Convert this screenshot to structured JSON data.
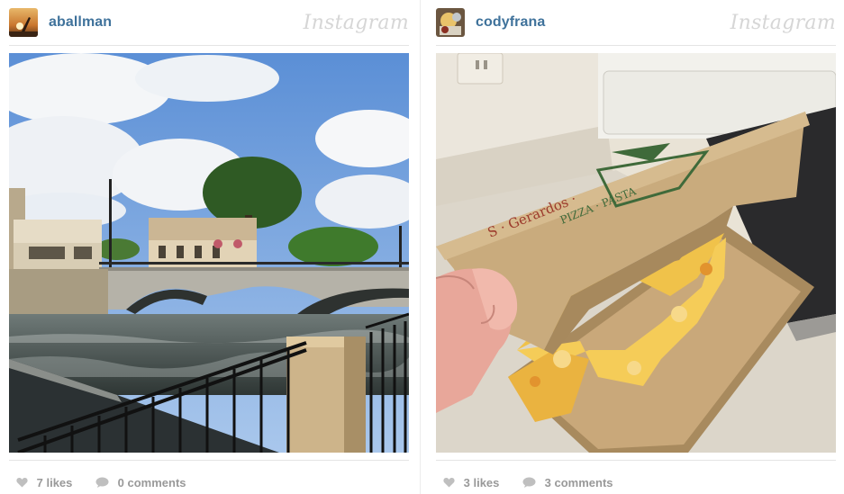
{
  "brand": "Instagram",
  "posts": [
    {
      "username": "aballman",
      "likes": "7 likes",
      "comments": "0 comments"
    },
    {
      "username": "codyfrana",
      "likes": "3 likes",
      "comments": "3 comments"
    }
  ],
  "colors": {
    "username": "#3f729b",
    "muted": "#999999",
    "brand": "#d6d6d6"
  }
}
